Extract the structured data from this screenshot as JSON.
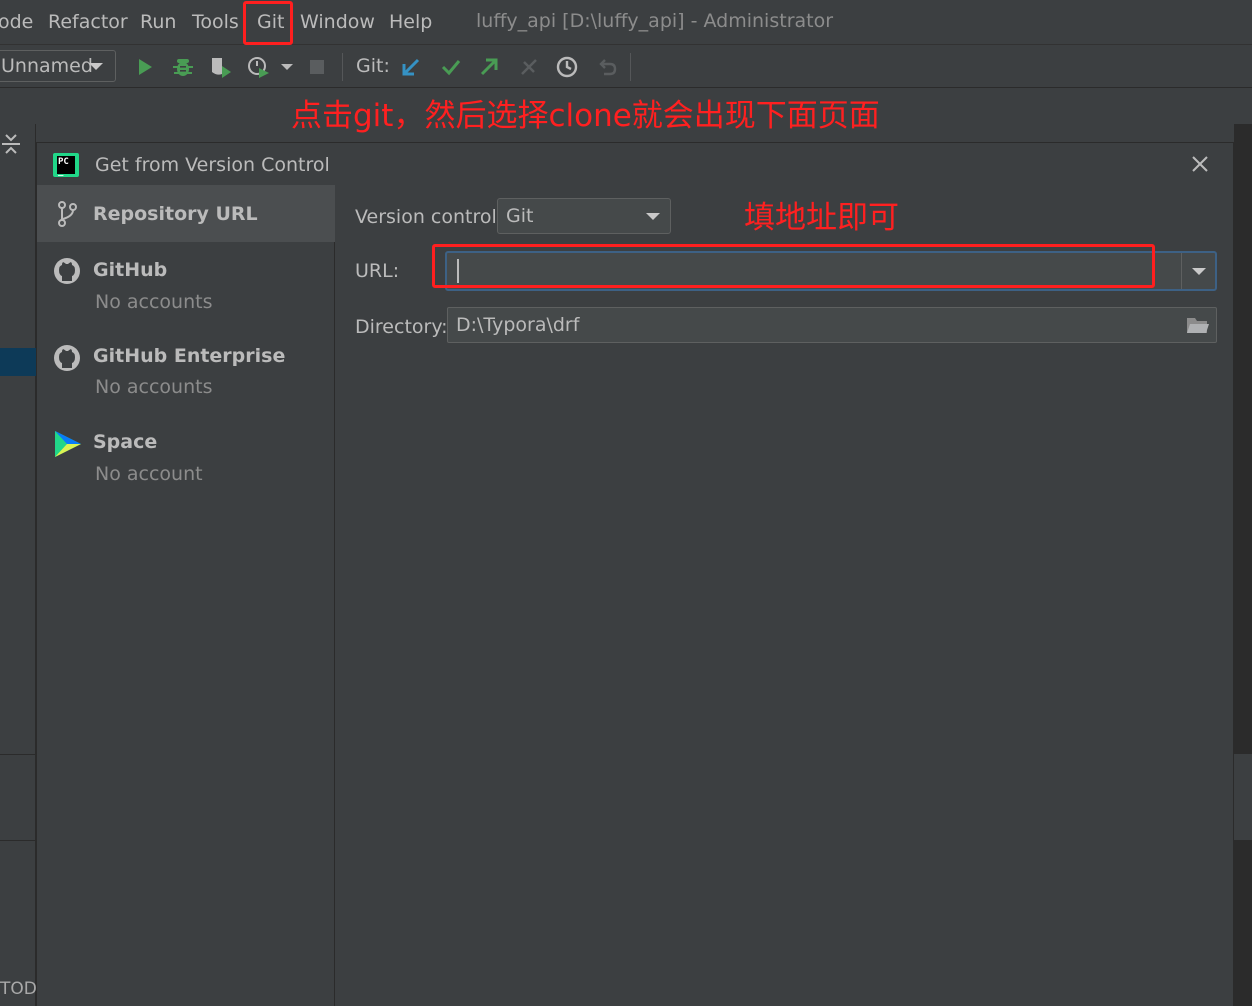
{
  "menu": {
    "items": [
      {
        "label": "ode"
      },
      {
        "label": "Refactor"
      },
      {
        "label": "Run"
      },
      {
        "label": "Tools"
      },
      {
        "label": "Git"
      },
      {
        "label": "Window"
      },
      {
        "label": "Help"
      }
    ],
    "window_title": "luffy_api [D:\\luffy_api] - Administrator"
  },
  "toolbar": {
    "run_config": "Unnamed",
    "git_label": "Git:",
    "icons": [
      "run-icon",
      "debug-icon",
      "coverage-icon",
      "profile-icon",
      "chevron-down-icon",
      "stop-icon",
      "git-update-icon",
      "git-commit-icon",
      "git-push-icon",
      "git-compare-icon",
      "history-icon",
      "rollback-icon"
    ]
  },
  "background": {
    "todo_label": "TOD"
  },
  "dialog": {
    "title": "Get from Version Control",
    "sidebar": [
      {
        "label": "Repository URL",
        "sub": "",
        "icon": "branch-icon"
      },
      {
        "label": "GitHub",
        "sub": "No accounts",
        "icon": "github-icon"
      },
      {
        "label": "GitHub Enterprise",
        "sub": "No accounts",
        "icon": "github-icon"
      },
      {
        "label": "Space",
        "sub": "No account",
        "icon": "space-icon"
      }
    ],
    "version_control_label": "Version control:",
    "version_control_value": "Git",
    "url_label": "URL:",
    "url_value": "",
    "directory_label": "Directory:",
    "directory_value": "D:\\Typora\\drf"
  },
  "annotations": {
    "top_note": "点击git，然后选择clone就会出现下面页面",
    "url_note": "填地址即可",
    "color": "#ff2020"
  },
  "colors": {
    "background": "#3c3f41",
    "accent_focus": "#3d6185",
    "selected": "#4b4e50"
  }
}
